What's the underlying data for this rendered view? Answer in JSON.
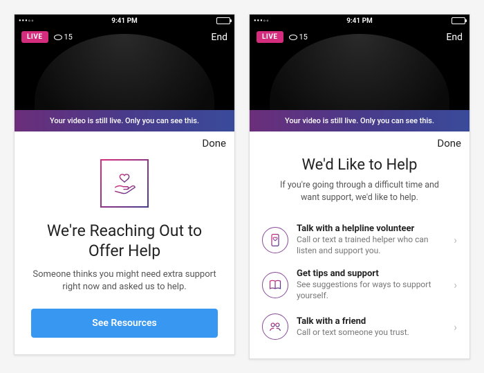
{
  "status": {
    "time": "9:41 PM",
    "signal": "•••◦◦"
  },
  "live": {
    "badge": "LIVE",
    "viewers": "15",
    "end": "End"
  },
  "notice": "Your video is still live. Only you can see this.",
  "done": "Done",
  "screenA": {
    "title": "We're Reaching Out to Offer Help",
    "body": "Someone thinks you might need extra support right now and asked us to help.",
    "cta": "See Resources"
  },
  "screenB": {
    "title": "We'd Like to Help",
    "body": "If you're going through a difficult time and want support, we'd like to help.",
    "options": [
      {
        "title": "Talk with a helpline volunteer",
        "sub": "Call or text a trained helper who can listen and support you."
      },
      {
        "title": "Get tips and support",
        "sub": "See suggestions for ways to support yourself."
      },
      {
        "title": "Talk with a friend",
        "sub": "Call or text someone you trust."
      }
    ]
  }
}
